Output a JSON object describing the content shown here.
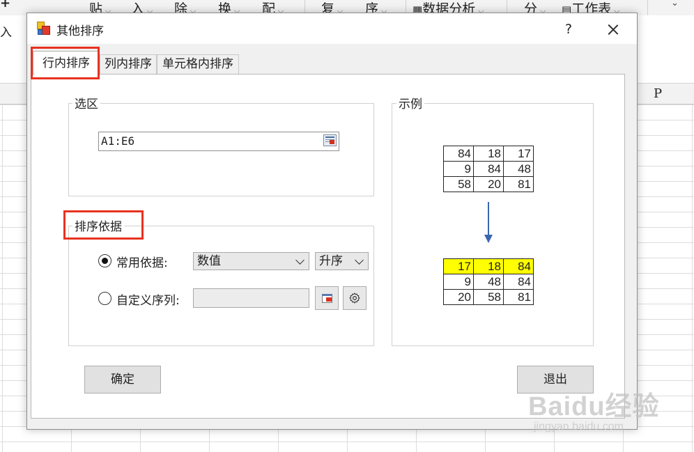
{
  "excel": {
    "ribbon_items": [
      {
        "label": "贴",
        "name": "ribbon-paste"
      },
      {
        "label": "入",
        "name": "ribbon-insert"
      },
      {
        "label": "除",
        "name": "ribbon-delete"
      },
      {
        "label": "换",
        "name": "ribbon-replace"
      },
      {
        "label": "配",
        "name": "ribbon-match"
      },
      {
        "label": "复",
        "name": "ribbon-repeat"
      },
      {
        "label": "序",
        "name": "ribbon-order"
      },
      {
        "label": "数据分析",
        "name": "ribbon-data-analysis"
      },
      {
        "label": "分",
        "name": "ribbon-split"
      },
      {
        "label": "工作表",
        "name": "ribbon-worksheet"
      }
    ],
    "left_label": "入",
    "column_letter": "P"
  },
  "dialog": {
    "title": "其他排序",
    "help": "?",
    "tabs": [
      "行内排序",
      "列内排序",
      "单元格内排序"
    ],
    "selection": {
      "label": "选区",
      "range_value": "A1:E6"
    },
    "sort_basis": {
      "label": "排序依据",
      "common_label": "常用依据:",
      "common_value": "数值",
      "order_value": "升序",
      "custom_label": "自定义序列:",
      "custom_value": ""
    },
    "example": {
      "label": "示例",
      "before": [
        [
          84,
          18,
          17
        ],
        [
          9,
          84,
          48
        ],
        [
          58,
          20,
          81
        ]
      ],
      "after": [
        [
          17,
          18,
          84
        ],
        [
          9,
          48,
          84
        ],
        [
          20,
          58,
          81
        ]
      ]
    },
    "ok_label": "确定",
    "exit_label": "退出"
  },
  "watermark": {
    "main": "Baidu经验",
    "sub": "jingyan.baidu.com"
  },
  "colors": {
    "highlight": "#ffff00",
    "annotation_red": "#e8321f",
    "arrow_blue": "#3a66b0"
  }
}
